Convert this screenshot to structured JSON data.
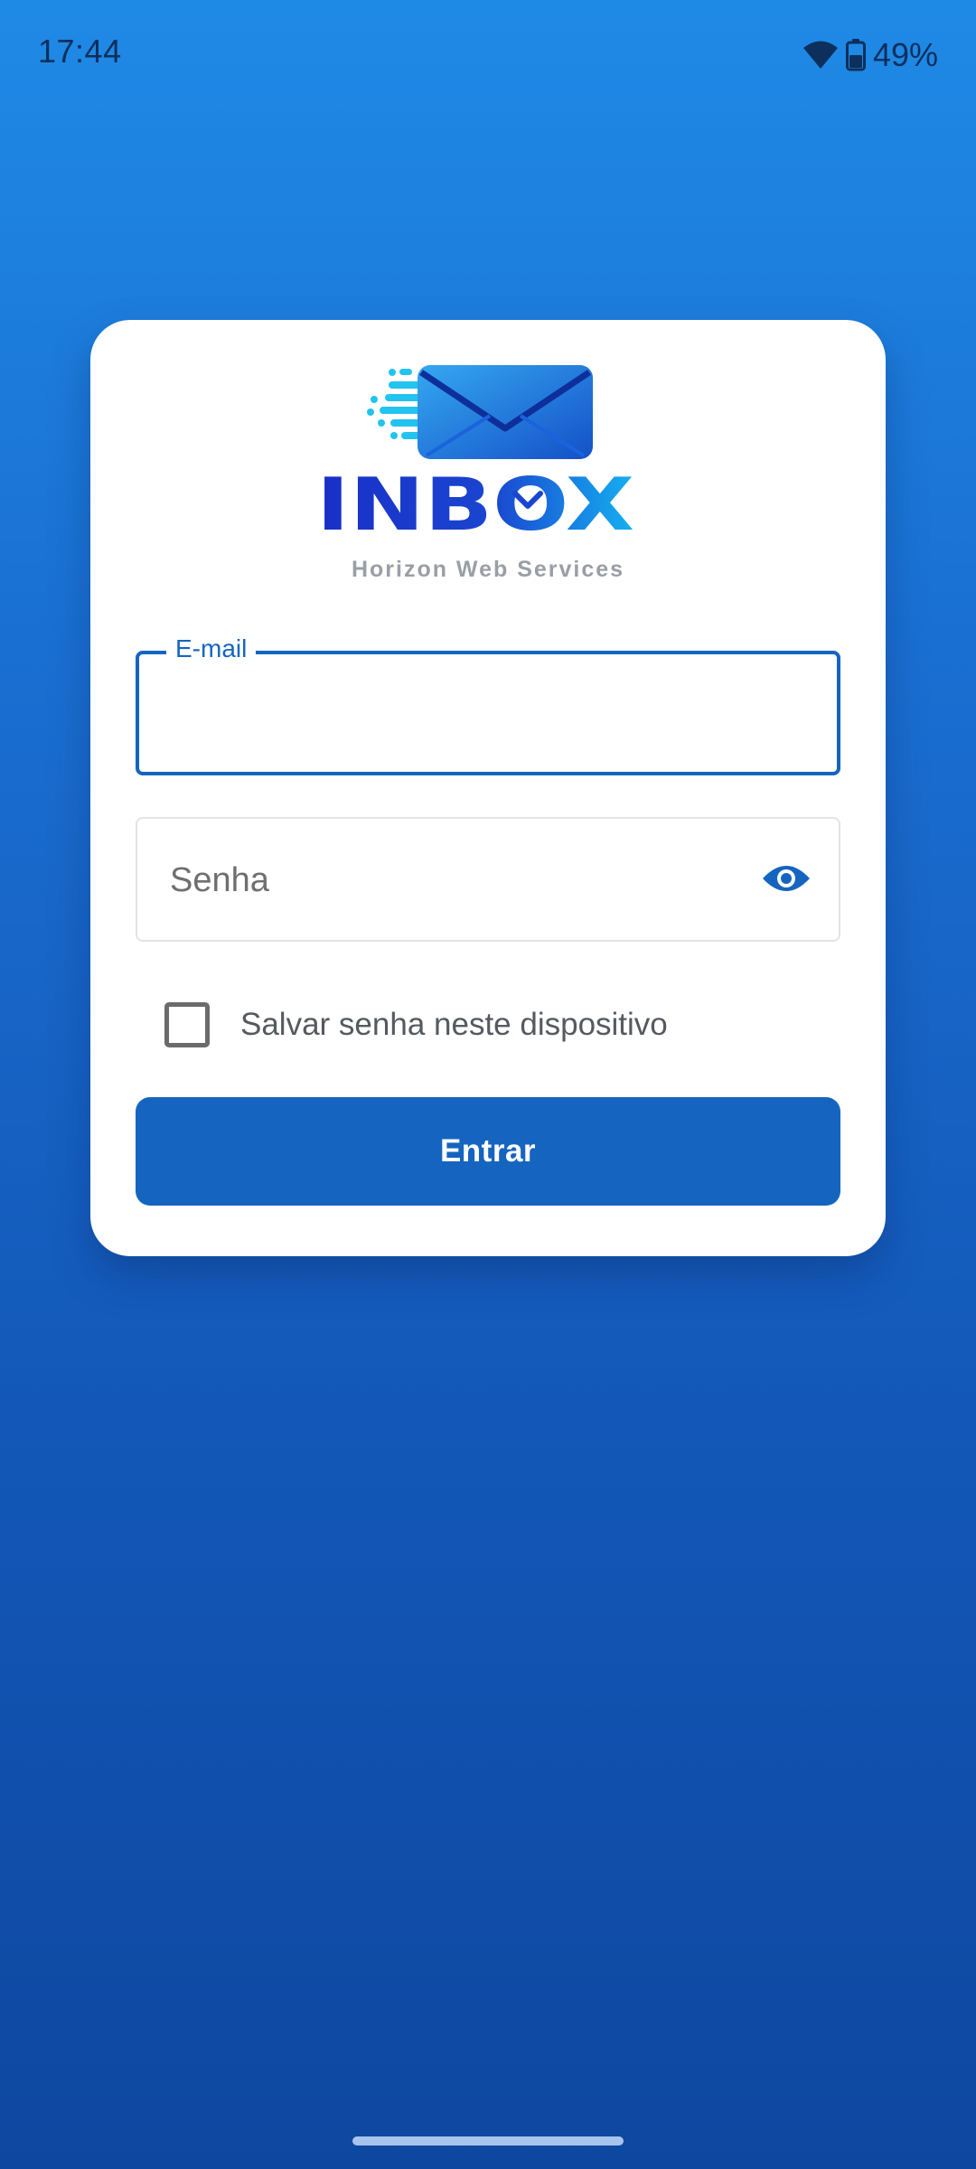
{
  "status_bar": {
    "time": "17:44",
    "battery_percent": "49%",
    "icons": [
      "wifi-icon",
      "battery-icon"
    ]
  },
  "logo": {
    "brand": "INBOX",
    "subtitle": "Horizon Web Services"
  },
  "form": {
    "email": {
      "label": "E-mail",
      "value": ""
    },
    "password": {
      "placeholder": "Senha",
      "value": "",
      "toggle_icon": "eye-icon"
    },
    "remember": {
      "label": "Salvar senha neste dispositivo",
      "checked": false
    },
    "submit_label": "Entrar"
  },
  "colors": {
    "primary": "#1565c0",
    "background_top": "#1f8ae6",
    "background_bottom": "#0e47a0",
    "card": "#ffffff"
  }
}
